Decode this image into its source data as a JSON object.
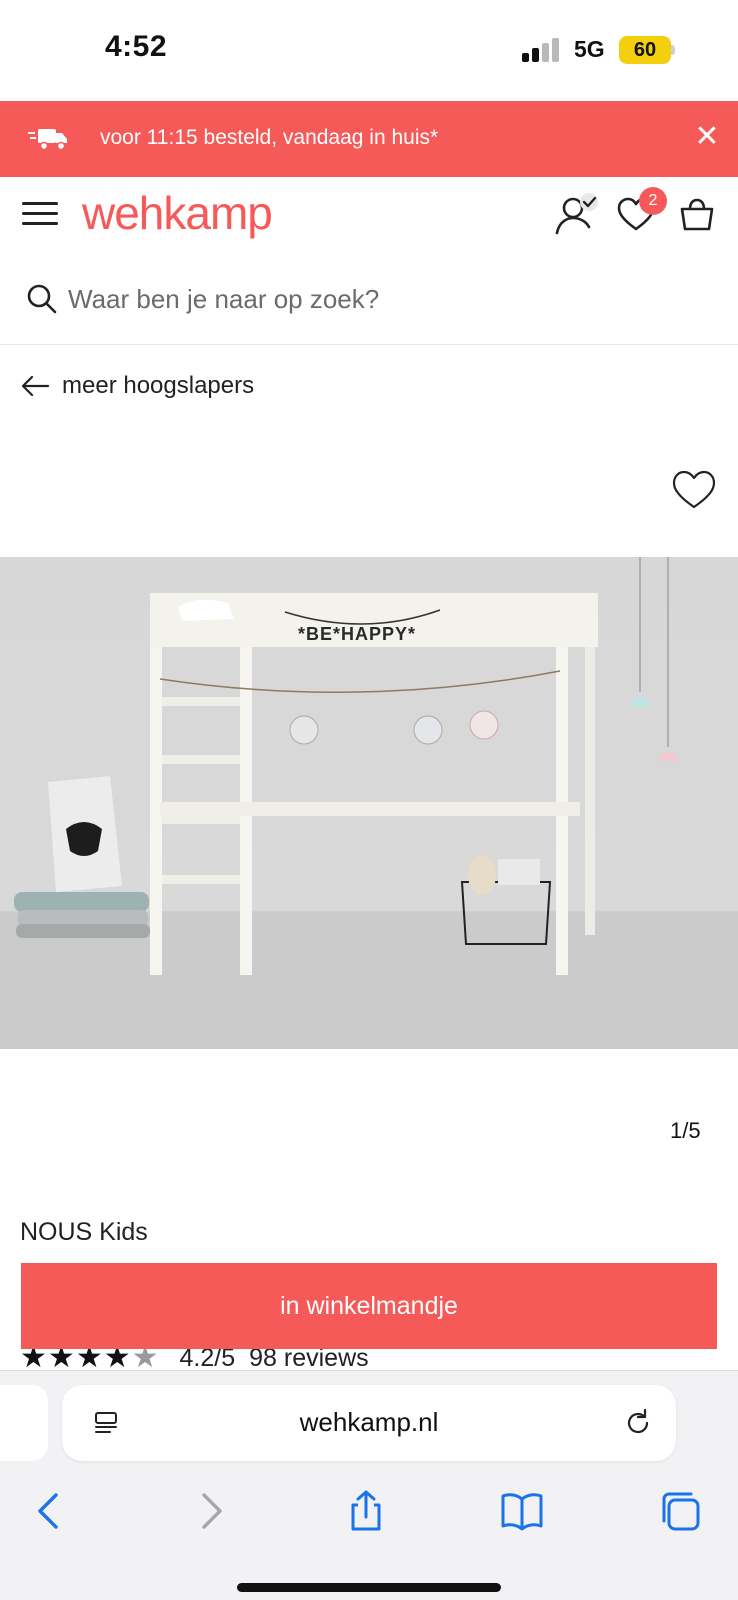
{
  "status_bar": {
    "time": "4:52",
    "network": "5G",
    "battery": "60"
  },
  "promo": {
    "text": "voor 11:15 besteld, vandaag in huis*",
    "close_icon": "close-icon",
    "icon": "delivery-truck-icon"
  },
  "header": {
    "brand": "wehkamp",
    "wishlist_count": "2",
    "icons": [
      "menu-icon",
      "account-check-icon",
      "heart-icon",
      "shopping-bag-icon"
    ]
  },
  "search": {
    "placeholder": "Waar ben je naar op zoek?"
  },
  "breadcrumb": {
    "back_label": "meer hoogslapers"
  },
  "gallery": {
    "counter": "1/5",
    "image_alt": "Witte hoogslaper met ladder, lampionnen en 'BE HAPPY' slinger"
  },
  "product": {
    "brand": "NOUS Kids",
    "rating_value": 4.2,
    "rating_text": "4.2/5",
    "reviews_text": "98 reviews",
    "cart_button": "in winkelmandje"
  },
  "browser": {
    "url": "wehkamp.nl",
    "toolbar_icons": [
      "back-arrow-icon",
      "forward-arrow-icon",
      "share-icon",
      "bookmarks-icon",
      "tabs-icon"
    ]
  },
  "colors": {
    "brand": "#f65a58",
    "accent_blue": "#1a73e8"
  }
}
